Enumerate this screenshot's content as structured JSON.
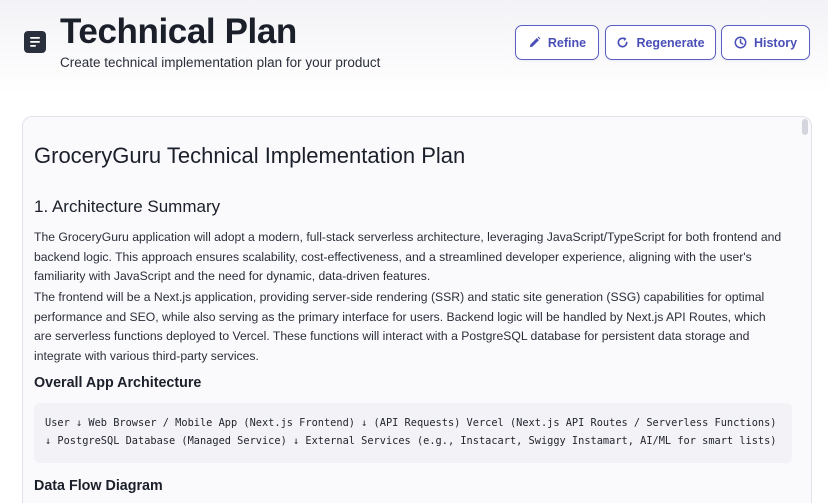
{
  "header": {
    "title": "Technical Plan",
    "subtitle": "Create technical implementation plan for your product",
    "icon": "document-icon"
  },
  "toolbar": {
    "refine_label": "Refine",
    "regenerate_label": "Regenerate",
    "history_label": "History",
    "accent": "#5a5fc4"
  },
  "document": {
    "title": "GroceryGuru Technical Implementation Plan",
    "section1": {
      "title": "1. Architecture Summary",
      "para1": "The GroceryGuru application will adopt a modern, full-stack serverless architecture, leveraging JavaScript/TypeScript for both frontend and backend logic. This approach ensures scalability, cost-effectiveness, and a streamlined developer experience, aligning with the user's familiarity with JavaScript and the need for dynamic, data-driven features.",
      "para2": "The frontend will be a Next.js application, providing server-side rendering (SSR) and static site generation (SSG) capabilities for optimal performance and SEO, while also serving as the primary interface for users. Backend logic will be handled by Next.js API Routes, which are serverless functions deployed to Vercel. These functions will interact with a PostgreSQL database for persistent data storage and integrate with various third-party services."
    },
    "overall_title": "Overall App Architecture",
    "overall_code": "User ↓ Web Browser / Mobile App (Next.js Frontend) ↓ (API Requests) Vercel (Next.js API Routes / Serverless Functions) ↓ PostgreSQL Database (Managed Service) ↓ External Services (e.g., Instacart, Swiggy Instamart, AI/ML for smart lists)",
    "dataflow_title": "Data Flow Diagram"
  }
}
